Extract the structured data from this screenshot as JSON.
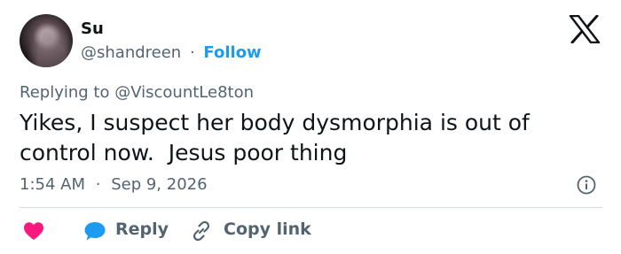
{
  "author": {
    "name": "Su",
    "handle": "@shandreen",
    "separator": "·",
    "follow_label": "Follow"
  },
  "replying": {
    "prefix": "Replying to",
    "mention": "@ViscountLe8ton"
  },
  "tweet": {
    "text": "Yikes, I suspect her body dysmorphia is out of\ncontrol now.  Jesus poor thing"
  },
  "meta": {
    "time": "1:54 AM",
    "separator": "·",
    "date": "Sep 9, 2026"
  },
  "actions": {
    "reply_label": "Reply",
    "copy_link_label": "Copy link"
  },
  "icons": {
    "logo": "x-logo-icon",
    "info": "info-icon",
    "like": "heart-icon",
    "reply": "reply-bubble-icon",
    "copy": "link-icon"
  },
  "colors": {
    "like": "#f91880",
    "reply": "#1d9bf0",
    "follow": "#1d9bf0",
    "muted": "#536471"
  }
}
